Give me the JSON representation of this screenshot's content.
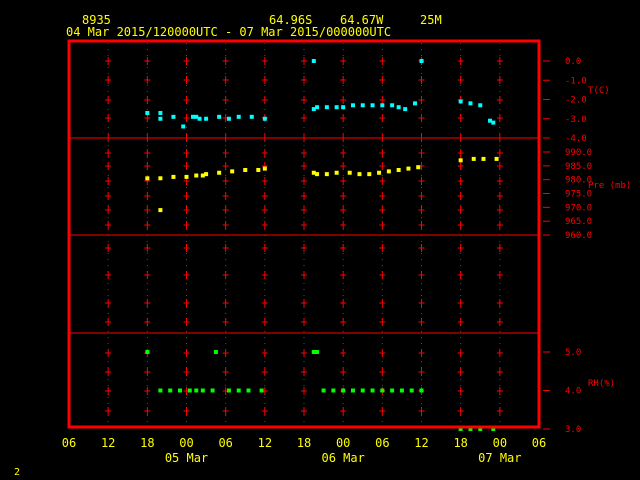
{
  "header": {
    "station": "8935",
    "lat": "64.96S",
    "lon": "64.67W",
    "elev": "25M",
    "period": "04 Mar 2015/120000UTC - 07 Mar 2015/000000UTC"
  },
  "page_number": "2",
  "colors": {
    "frame": "#ff0000",
    "axis_text": "#ffff00",
    "temp": "#00ffff",
    "pres": "#ffff00",
    "rh": "#00ff00",
    "labels": "#ff0000"
  },
  "chart_data": {
    "type": "scatter",
    "x_axis": {
      "unit": "hours from 04 Mar 2015 06 UTC",
      "range": [
        0,
        72
      ],
      "ticks": [
        {
          "x": 0,
          "label": "06"
        },
        {
          "x": 6,
          "label": "12"
        },
        {
          "x": 12,
          "label": "18"
        },
        {
          "x": 18,
          "label": "00"
        },
        {
          "x": 24,
          "label": "06"
        },
        {
          "x": 30,
          "label": "12"
        },
        {
          "x": 36,
          "label": "18"
        },
        {
          "x": 42,
          "label": "00"
        },
        {
          "x": 48,
          "label": "06"
        },
        {
          "x": 54,
          "label": "12"
        },
        {
          "x": 60,
          "label": "18"
        },
        {
          "x": 66,
          "label": "00"
        },
        {
          "x": 72,
          "label": "06"
        }
      ],
      "date_labels": [
        {
          "x": 18,
          "label": "05 Mar"
        },
        {
          "x": 42,
          "label": "06 Mar"
        },
        {
          "x": 66,
          "label": "07 Mar"
        }
      ]
    },
    "panels": [
      {
        "id": "temperature",
        "name": "T(C)",
        "ylim": [
          -4.0,
          0.0
        ],
        "ticks": [
          "0.0",
          "-1.0",
          "-2.0",
          "-3.0",
          "-4.0"
        ],
        "tick_values": [
          0,
          -1,
          -2,
          -3,
          -4
        ],
        "series_label_at": -1.5,
        "points": [
          [
            12,
            -2.7
          ],
          [
            14,
            -2.7
          ],
          [
            14,
            -3.0
          ],
          [
            16,
            -2.9
          ],
          [
            17.5,
            -3.4
          ],
          [
            19,
            -2.9
          ],
          [
            19.5,
            -2.9
          ],
          [
            20,
            -3.0
          ],
          [
            21,
            -3.0
          ],
          [
            23,
            -2.9
          ],
          [
            24.5,
            -3.0
          ],
          [
            26,
            -2.9
          ],
          [
            28,
            -2.9
          ],
          [
            30,
            -3.0
          ],
          [
            37.5,
            0.0
          ],
          [
            37.5,
            -2.5
          ],
          [
            38,
            -2.4
          ],
          [
            39.5,
            -2.4
          ],
          [
            41,
            -2.4
          ],
          [
            42,
            -2.4
          ],
          [
            43.5,
            -2.3
          ],
          [
            45,
            -2.3
          ],
          [
            46.5,
            -2.3
          ],
          [
            48,
            -2.3
          ],
          [
            49.5,
            -2.3
          ],
          [
            50.5,
            -2.4
          ],
          [
            51.5,
            -2.5
          ],
          [
            53,
            -2.2
          ],
          [
            54,
            0.0
          ],
          [
            60,
            -2.1
          ],
          [
            61.5,
            -2.2
          ],
          [
            63,
            -2.3
          ],
          [
            64.5,
            -3.1
          ],
          [
            65,
            -3.2
          ]
        ]
      },
      {
        "id": "pressure",
        "name": "Pre (mb)",
        "ylim": [
          960.0,
          990.0
        ],
        "ticks": [
          "990.0",
          "985.0",
          "980.0",
          "975.0",
          "970.0",
          "965.0",
          "960.0"
        ],
        "tick_values": [
          990,
          985,
          980,
          975,
          970,
          965,
          960
        ],
        "series_label_at": 978,
        "points": [
          [
            12,
            980.5
          ],
          [
            14,
            969
          ],
          [
            14,
            980.5
          ],
          [
            16,
            981
          ],
          [
            18,
            981
          ],
          [
            19.5,
            981.5
          ],
          [
            20.5,
            981.5
          ],
          [
            21,
            982
          ],
          [
            23,
            982.5
          ],
          [
            25,
            983
          ],
          [
            27,
            983.5
          ],
          [
            29,
            983.5
          ],
          [
            30,
            984
          ],
          [
            37.5,
            982.5
          ],
          [
            38,
            982
          ],
          [
            39.5,
            982
          ],
          [
            41,
            982.5
          ],
          [
            43,
            982.5
          ],
          [
            44.5,
            982
          ],
          [
            46,
            982
          ],
          [
            47.5,
            982.5
          ],
          [
            49,
            983
          ],
          [
            50.5,
            983.5
          ],
          [
            52,
            984
          ],
          [
            53.5,
            984.5
          ],
          [
            60,
            987
          ],
          [
            62,
            987.5
          ],
          [
            63.5,
            987.5
          ],
          [
            65.5,
            987.5
          ]
        ]
      },
      {
        "id": "relative_humidity",
        "name": "RH(%)",
        "ylim": [
          3.0,
          5.0
        ],
        "ticks": [
          "5.0",
          "4.0",
          "3.0"
        ],
        "tick_values": [
          5,
          4,
          3
        ],
        "series_label_at": 4.2,
        "points": [
          [
            12,
            5.0
          ],
          [
            14,
            4.0
          ],
          [
            15.5,
            4.0
          ],
          [
            17,
            4.0
          ],
          [
            18.5,
            4.0
          ],
          [
            19.5,
            4.0
          ],
          [
            20.5,
            4.0
          ],
          [
            22,
            4.0
          ],
          [
            22.5,
            5.0
          ],
          [
            24.5,
            4.0
          ],
          [
            26,
            4.0
          ],
          [
            27.5,
            4.0
          ],
          [
            29.5,
            4.0
          ],
          [
            37.5,
            5.0
          ],
          [
            38,
            5.0
          ],
          [
            39,
            4.0
          ],
          [
            40.5,
            4.0
          ],
          [
            42,
            4.0
          ],
          [
            43.5,
            4.0
          ],
          [
            45,
            4.0
          ],
          [
            46.5,
            4.0
          ],
          [
            48,
            4.0
          ],
          [
            49.5,
            4.0
          ],
          [
            51,
            4.0
          ],
          [
            52.5,
            4.0
          ],
          [
            54,
            4.0
          ],
          [
            60,
            3.0
          ],
          [
            61.5,
            3.0
          ],
          [
            63,
            3.0
          ],
          [
            65,
            3.0
          ]
        ]
      }
    ]
  }
}
